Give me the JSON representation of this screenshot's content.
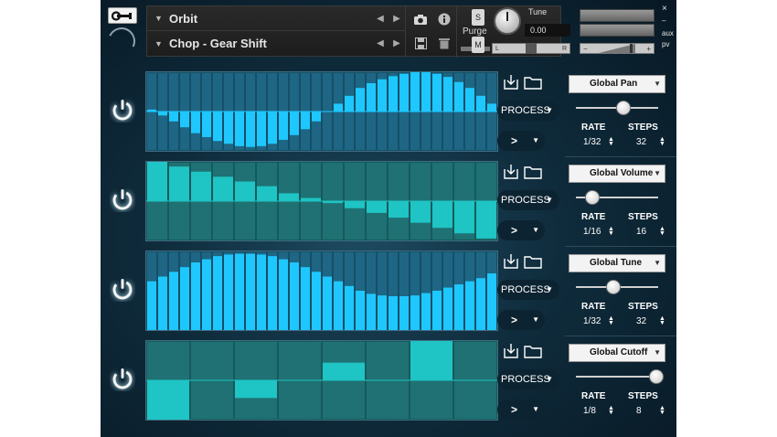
{
  "header": {
    "instrument_name": "Orbit",
    "preset_name": "Chop - Gear Shift",
    "purge_label": "Purge",
    "solo_label": "S",
    "mute_label": "M",
    "tune_label": "Tune",
    "tune_value": "0.00",
    "pan_left": "L",
    "pan_right": "R",
    "vol_minus": "−",
    "vol_plus": "+",
    "aux_label": "aux",
    "pv_label": "pv",
    "close_label": "×",
    "minimize_label": "–",
    "instrument_arrows": [
      "◀",
      "▶"
    ],
    "preset_arrows": [
      "◀",
      "▶"
    ]
  },
  "rows": [
    {
      "param": "Global Pan",
      "process_label": "PROCESS",
      "next_label": ">",
      "rate_label": "RATE",
      "rate": "1/32",
      "steps_label": "STEPS",
      "steps": "32",
      "amount": 0.58,
      "enabled": true,
      "bipolar": true,
      "sequence": [
        0.05,
        -0.1,
        -0.25,
        -0.4,
        -0.55,
        -0.65,
        -0.75,
        -0.82,
        -0.88,
        -0.9,
        -0.88,
        -0.82,
        -0.72,
        -0.6,
        -0.45,
        -0.25,
        0.0,
        0.2,
        0.4,
        0.6,
        0.72,
        0.82,
        0.9,
        0.96,
        1.0,
        1.0,
        0.96,
        0.88,
        0.75,
        0.6,
        0.4,
        0.2
      ]
    },
    {
      "param": "Global Volume",
      "process_label": "PROCESS",
      "next_label": ">",
      "rate_label": "RATE",
      "rate": "1/16",
      "steps_label": "STEPS",
      "steps": "16",
      "amount": 0.2,
      "enabled": true,
      "bipolar": true,
      "sequence": [
        1.0,
        0.88,
        0.75,
        0.62,
        0.5,
        0.38,
        0.2,
        0.08,
        -0.05,
        -0.18,
        -0.3,
        -0.42,
        -0.55,
        -0.68,
        -0.82,
        -0.95
      ]
    },
    {
      "param": "Global Tune",
      "process_label": "PROCESS",
      "next_label": ">",
      "rate_label": "RATE",
      "rate": "1/32",
      "steps_label": "STEPS",
      "steps": "32",
      "amount": 0.45,
      "enabled": true,
      "bipolar": false,
      "sequence": [
        0.62,
        0.68,
        0.74,
        0.8,
        0.86,
        0.9,
        0.94,
        0.96,
        0.97,
        0.97,
        0.96,
        0.94,
        0.9,
        0.86,
        0.8,
        0.74,
        0.68,
        0.62,
        0.56,
        0.5,
        0.46,
        0.44,
        0.43,
        0.43,
        0.44,
        0.47,
        0.5,
        0.54,
        0.58,
        0.62,
        0.66,
        0.72
      ]
    },
    {
      "param": "Global Cutoff",
      "process_label": "PROCESS",
      "next_label": ">",
      "rate_label": "RATE",
      "rate": "1/8",
      "steps_label": "STEPS",
      "steps": "8",
      "amount": 0.98,
      "enabled": true,
      "bipolar": true,
      "sequence": [
        -1.0,
        0.0,
        -0.45,
        0.0,
        0.45,
        0.0,
        1.0,
        0.0
      ]
    }
  ],
  "colors": {
    "bar_blue": "#1ec8ff",
    "bar_teal": "#1fc4c4",
    "grid_bg_blue": "#1a5f7c",
    "grid_bg_teal": "#1a6a6e"
  }
}
